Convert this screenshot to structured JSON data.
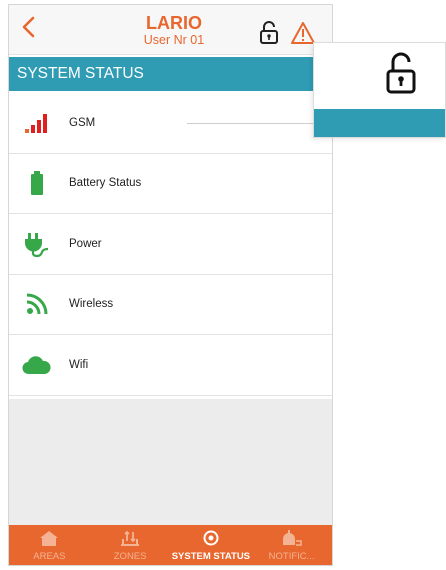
{
  "header": {
    "title": "LARIO",
    "subtitle": "User Nr 01",
    "back_icon": "chevron-left-icon",
    "lock_icon": "unlocked-padlock-icon",
    "warning_icon": "warning-triangle-icon"
  },
  "section": {
    "title": "SYSTEM STATUS"
  },
  "status_items": [
    {
      "label": "GSM",
      "icon": "signal-bars-icon"
    },
    {
      "label": "Battery Status",
      "icon": "battery-icon"
    },
    {
      "label": "Power",
      "icon": "power-plug-icon"
    },
    {
      "label": "Wireless",
      "icon": "wireless-icon"
    },
    {
      "label": "Wifi",
      "icon": "cloud-icon"
    }
  ],
  "tabbar": {
    "tabs": [
      {
        "label": "AREAS",
        "icon": "home-icon",
        "active": false
      },
      {
        "label": "ZONES",
        "icon": "zones-icon",
        "active": false
      },
      {
        "label": "SYSTEM STATUS",
        "icon": "system-status-icon",
        "active": true
      },
      {
        "label": "NOTIFIC...",
        "icon": "notification-icon",
        "active": false
      }
    ]
  },
  "popover": {
    "icon": "unlocked-padlock-icon"
  },
  "colors": {
    "accent_orange": "#e8672e",
    "section_teal": "#2f9cb4",
    "icon_green": "#37a84a",
    "signal_red": "#e02020"
  }
}
